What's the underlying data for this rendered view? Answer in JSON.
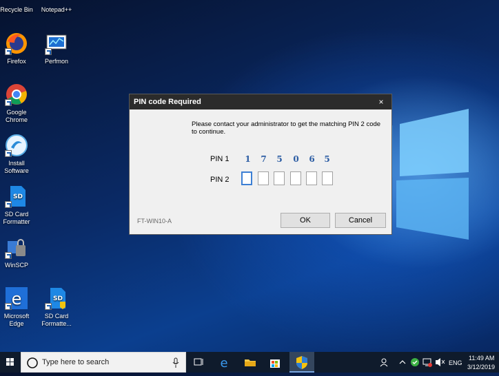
{
  "desktop": {
    "icons": [
      {
        "label": "Recycle Bin"
      },
      {
        "label": "Notepad++"
      },
      {
        "label": "Firefox"
      },
      {
        "label": "Perfmon"
      },
      {
        "label": "Google Chrome"
      },
      {
        "label": "Install Software"
      },
      {
        "label": "SD Card Formatter"
      },
      {
        "label": "WinSCP"
      },
      {
        "label": "Microsoft Edge"
      },
      {
        "label": "SD Card Formatte..."
      }
    ]
  },
  "dialog": {
    "title": "PIN code Required",
    "close_glyph": "×",
    "message": "Please contact your administrator to get the matching PIN 2 code to continue.",
    "pin1_label": "PIN 1",
    "pin1_digits": [
      "1",
      "7",
      "5",
      "0",
      "6",
      "5"
    ],
    "pin2_label": "PIN 2",
    "pin2_values": [
      "",
      "",
      "",
      "",
      "",
      ""
    ],
    "machine_name": "FT-WIN10-A",
    "ok_label": "OK",
    "cancel_label": "Cancel"
  },
  "taskbar": {
    "search_placeholder": "Type here to search",
    "language": "ENG",
    "time": "11:49 AM",
    "date": "3/12/2019"
  }
}
